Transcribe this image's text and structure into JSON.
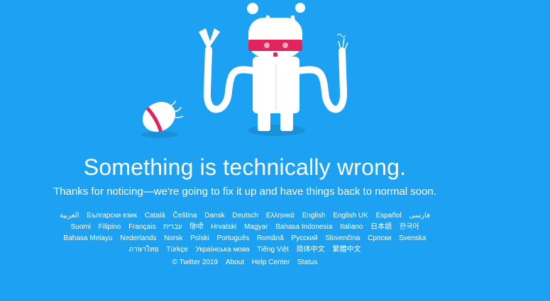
{
  "error": {
    "headline": "Something is technically wrong.",
    "message": "Thanks for noticing—we're going to fix it up and have things back to normal soon."
  },
  "languages": [
    "العربية",
    "Български език",
    "Català",
    "Čeština",
    "Dansk",
    "Deutsch",
    "Ελληνικά",
    "English",
    "English UK",
    "Español",
    "فارسی",
    "Suomi",
    "Filipino",
    "Français",
    "עברית",
    "हिन्दी",
    "Hrvatski",
    "Magyar",
    "Bahasa Indonesia",
    "Italiano",
    "日本語",
    "한국어",
    "Bahasa Melayu",
    "Nederlands",
    "Norsk",
    "Polski",
    "Português",
    "Română",
    "Русский",
    "Slovenčina",
    "Српски",
    "Svenska",
    "ภาษาไทย",
    "Türkçe",
    "Українська мова",
    "Tiếng Việt",
    "简体中文",
    "繁體中文"
  ],
  "footer": {
    "copyright": "© Twitter 2019",
    "about": "About",
    "help_center": "Help Center",
    "status": "Status"
  },
  "colors": {
    "background": "#1da1f2",
    "robot_visor": "#e0245e",
    "robot_body": "#ffffff"
  },
  "illustration": {
    "icon": "broken-robot-icon"
  }
}
